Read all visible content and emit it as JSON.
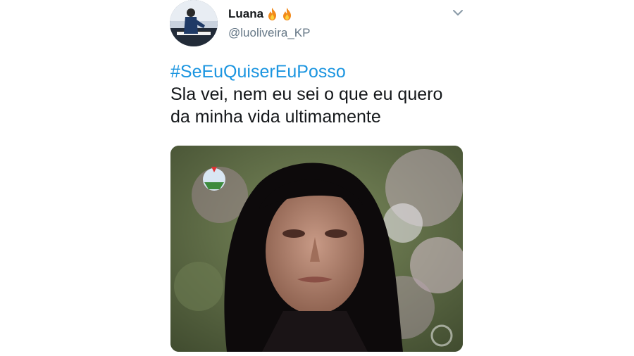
{
  "tweet": {
    "display_name": "Luana",
    "handle": "@luoliveira_KP",
    "hashtag": "#SeEuQuiserEuPosso",
    "text_line1": "Sla vei, nem eu sei o que eu quero",
    "text_line2": "da minha vida ultimamente"
  },
  "icons": {
    "name_emojis": [
      "flame-icon",
      "flame-icon"
    ],
    "menu": "chevron-down-icon"
  },
  "colors": {
    "hashtag": "#1b95e0",
    "name": "#14171a",
    "handle": "#657786"
  }
}
